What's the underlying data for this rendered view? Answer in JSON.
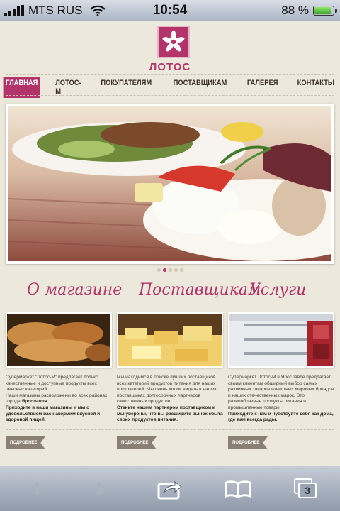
{
  "status_bar": {
    "carrier": "MTS RUS",
    "time": "10:54",
    "battery_percent": "88 %",
    "battery_level": 0.88
  },
  "site": {
    "logo_text": "ЛОТОС",
    "nav": [
      {
        "label": "ГЛАВНАЯ",
        "active": true
      },
      {
        "label": "ЛОТОС-М",
        "active": false
      },
      {
        "label": "ПОКУПАТЕЛЯМ",
        "active": false
      },
      {
        "label": "ПОСТАВЩИКАМ",
        "active": false
      },
      {
        "label": "ГАЛЕРЕЯ",
        "active": false
      },
      {
        "label": "КОНТАКТЫ",
        "active": false
      }
    ],
    "slider_dots": 5,
    "slider_active_dot": 2
  },
  "columns": [
    {
      "heading": "О магазине",
      "text_html": "Супермаркет \"Лотос-М\" предлагает только качественные и доступные продукты всех ценовых категорий.<br>Наши магазины расположены во всех районах города <b>Ярославля</b>.<br><b>Приходите в наши магазины и мы с удовольствием вас накормим вкусной и здоровой пищей.</b>",
      "more": "ПОДРОБНЕЕ"
    },
    {
      "heading": "Поставщикам",
      "text_html": "Мы находимся в поиске лучших поставщиков всех категорий продуктов питания для наших покупателей. Мы очень хотим видеть в наших поставщиках долгосрочных партнеров качественных продуктов.<br><b>Станьте нашим партнером поставщиком и мы уверены, что вы расширите рынок сбыта своих продуктов питания.</b>",
      "more": "ПОДРОБНЕЕ"
    },
    {
      "heading": "Услуги",
      "text_html": "Супермаркет Лотос-М в Ярославле предлагает своим клиентам обширный выбор самых различных товаров известных мировых брендов и наших отечественных марок. Это разнообразные продукты питания и промышленные товары.<br><b>Приходите к нам и чувствуйте себя как дома, где вам всегда рады.</b>",
      "more": "ПОДРОБНЕЕ"
    }
  ],
  "toolbar": {
    "tabs_count": "3"
  }
}
